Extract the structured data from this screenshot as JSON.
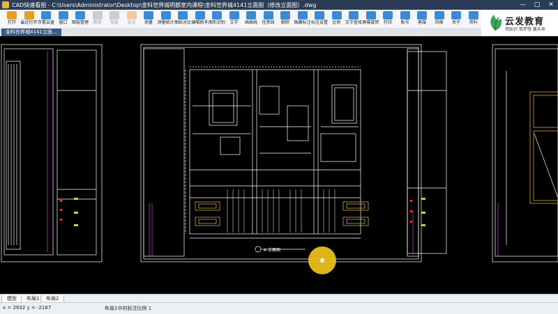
{
  "titlebar": {
    "title": "CAD快速看图 - C:\\Users\\Administrator\\Desktop\\金科世界城明都室内课程\\金科世界城4141立面图（修改立面图）.dwg"
  },
  "toolbar": [
    {
      "label": "打开",
      "icon": "folder-open-icon",
      "color": "#e0a020",
      "disabled": false
    },
    {
      "label": "最近打开",
      "icon": "folder-recent-icon",
      "color": "#e0a020",
      "disabled": false
    },
    {
      "label": "存看云盘",
      "icon": "cloud-icon",
      "color": "#3a8ad8",
      "disabled": false
    },
    {
      "label": "窗口",
      "icon": "window-icon",
      "color": "#3a8ad8",
      "disabled": false
    },
    {
      "label": "图层管理",
      "icon": "layers-icon",
      "color": "#3a8ad8",
      "disabled": false
    },
    {
      "label": "撤销",
      "icon": "undo-icon",
      "color": "#999999",
      "disabled": true
    },
    {
      "label": "恢复",
      "icon": "redo-icon",
      "color": "#999999",
      "disabled": true
    },
    {
      "label": "会员",
      "icon": "vip-icon",
      "color": "#e0a020",
      "disabled": true
    },
    {
      "label": "测量",
      "icon": "measure-icon",
      "color": "#3a8ad8",
      "disabled": false
    },
    {
      "label": "测量统计",
      "icon": "measure-stats-icon",
      "color": "#3a8ad8",
      "disabled": false
    },
    {
      "label": "图纸对比",
      "icon": "compare-icon",
      "color": "#3a8ad8",
      "disabled": false
    },
    {
      "label": "编辑助手",
      "icon": "edit-helper-icon",
      "color": "#3a8ad8",
      "disabled": false
    },
    {
      "label": "图形识别",
      "icon": "recognize-icon",
      "color": "#3a8ad8",
      "disabled": false
    },
    {
      "label": "文字",
      "icon": "text-icon",
      "color": "#3a8ad8",
      "disabled": false
    },
    {
      "label": "画曲线",
      "icon": "curve-icon",
      "color": "#3a8ad8",
      "disabled": false
    },
    {
      "label": "任意线",
      "icon": "polyline-icon",
      "color": "#3a8ad8",
      "disabled": false
    },
    {
      "label": "删除",
      "icon": "delete-icon",
      "color": "#3a8ad8",
      "disabled": false
    },
    {
      "label": "隐藏标注",
      "icon": "hide-annotation-icon",
      "color": "#3a8ad8",
      "disabled": false
    },
    {
      "label": "标注设置",
      "icon": "annotation-settings-icon",
      "color": "#3a8ad8",
      "disabled": false
    },
    {
      "label": "比例",
      "icon": "scale-icon",
      "color": "#3a8ad8",
      "disabled": false
    },
    {
      "label": "文字查找",
      "icon": "text-search-icon",
      "color": "#3a8ad8",
      "disabled": false
    },
    {
      "label": "屏幕旋转",
      "icon": "rotate-icon",
      "color": "#3a8ad8",
      "disabled": false
    },
    {
      "label": "打印",
      "icon": "print-icon",
      "color": "#3a8ad8",
      "disabled": false
    },
    {
      "label": "账号",
      "icon": "account-icon",
      "color": "#3a8ad8",
      "disabled": false
    },
    {
      "label": "客服",
      "icon": "support-icon",
      "color": "#3a8ad8",
      "disabled": false
    },
    {
      "label": "风格",
      "icon": "style-icon",
      "color": "#3a8ad8",
      "disabled": false
    },
    {
      "label": "关于",
      "icon": "about-icon",
      "color": "#3a8ad8",
      "disabled": false
    },
    {
      "label": "资料",
      "icon": "docs-icon",
      "color": "#3a8ad8",
      "disabled": false
    }
  ],
  "logo": {
    "brand": "云发教育",
    "slogan": "用知识 筑梦想 赢未来"
  },
  "document_tab": {
    "label": "金科世界城4141立面..."
  },
  "drawing": {
    "title_mark": "A 立面图"
  },
  "layout_tabs": [
    "模型",
    "布局1",
    "布局2"
  ],
  "status": {
    "coords": "x = 2932  y = -2167",
    "message": "布局1中的标注比例 1"
  },
  "colors": {
    "titlebar": "#2b3d55",
    "cad_lines": "#ffffff",
    "cad_yellow": "#e8c34a",
    "cad_magenta": "#e040e0",
    "cad_red": "#ff3030",
    "cursor": "#f0c419"
  }
}
